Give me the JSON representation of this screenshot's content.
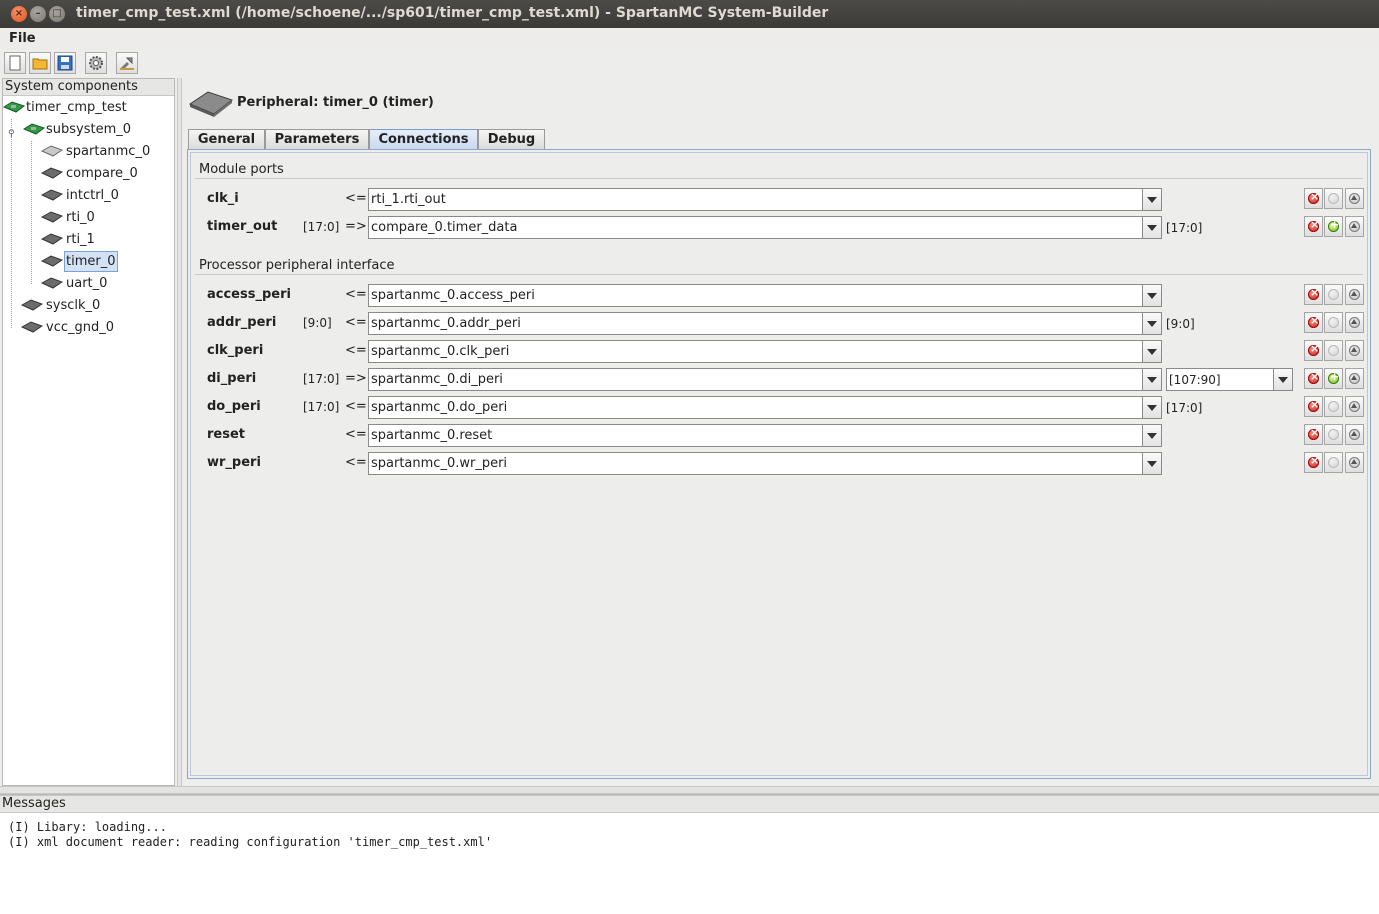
{
  "window": {
    "title": "timer_cmp_test.xml (/home/schoene/.../sp601/timer_cmp_test.xml) - SpartanMC System-Builder"
  },
  "menu": {
    "file": "File"
  },
  "toolbar": {
    "buttons": [
      "new-icon",
      "open-folder-icon",
      "save-icon",
      "settings-gear-icon",
      "build-icon"
    ]
  },
  "tree": {
    "header": "System components",
    "items": [
      {
        "label": "timer_cmp_test",
        "icon": "board-icon"
      },
      {
        "label": "subsystem_0",
        "icon": "board-icon"
      },
      {
        "label": "spartanmc_0",
        "icon": "chip-icon"
      },
      {
        "label": "compare_0",
        "icon": "chip-icon"
      },
      {
        "label": "intctrl_0",
        "icon": "chip-icon"
      },
      {
        "label": "rti_0",
        "icon": "chip-icon"
      },
      {
        "label": "rti_1",
        "icon": "chip-icon"
      },
      {
        "label": "timer_0",
        "icon": "chip-icon",
        "selected": true
      },
      {
        "label": "uart_0",
        "icon": "chip-icon"
      },
      {
        "label": "sysclk_0",
        "icon": "chip-icon"
      },
      {
        "label": "vcc_gnd_0",
        "icon": "chip-icon"
      }
    ]
  },
  "peripheral": {
    "title": "Peripheral: timer_0 (timer)"
  },
  "tabs": [
    {
      "label": "General"
    },
    {
      "label": "Parameters"
    },
    {
      "label": "Connections",
      "active": true
    },
    {
      "label": "Debug"
    }
  ],
  "module_ports": {
    "title": "Module ports",
    "rows": [
      {
        "name": "clk_i",
        "width": "",
        "dir": "<=",
        "value": "rti_1.rti_out",
        "range": "",
        "add_enabled": false
      },
      {
        "name": "timer_out",
        "width": "[17:0]",
        "dir": "=>",
        "value": "compare_0.timer_data",
        "range": "[17:0]",
        "add_enabled": true
      }
    ]
  },
  "peri_interface": {
    "title": "Processor peripheral interface",
    "rows": [
      {
        "name": "access_peri",
        "width": "",
        "dir": "<=",
        "value": "spartanmc_0.access_peri",
        "range": "",
        "add_enabled": false
      },
      {
        "name": "addr_peri",
        "width": "[9:0]",
        "dir": "<=",
        "value": "spartanmc_0.addr_peri",
        "range": "[9:0]",
        "add_enabled": false
      },
      {
        "name": "clk_peri",
        "width": "",
        "dir": "<=",
        "value": "spartanmc_0.clk_peri",
        "range": "",
        "add_enabled": false
      },
      {
        "name": "di_peri",
        "width": "[17:0]",
        "dir": "=>",
        "value": "spartanmc_0.di_peri",
        "range_select": "[107:90]",
        "add_enabled": true
      },
      {
        "name": "do_peri",
        "width": "[17:0]",
        "dir": "<=",
        "value": "spartanmc_0.do_peri",
        "range": "[17:0]",
        "add_enabled": false
      },
      {
        "name": "reset",
        "width": "",
        "dir": "<=",
        "value": "spartanmc_0.reset",
        "range": "",
        "add_enabled": false
      },
      {
        "name": "wr_peri",
        "width": "",
        "dir": "<=",
        "value": "spartanmc_0.wr_peri",
        "range": "",
        "add_enabled": false
      }
    ]
  },
  "messages": {
    "header": "Messages",
    "lines": [
      "(I) Libary: loading...",
      "(I) xml document reader: reading configuration 'timer_cmp_test.xml'"
    ]
  }
}
